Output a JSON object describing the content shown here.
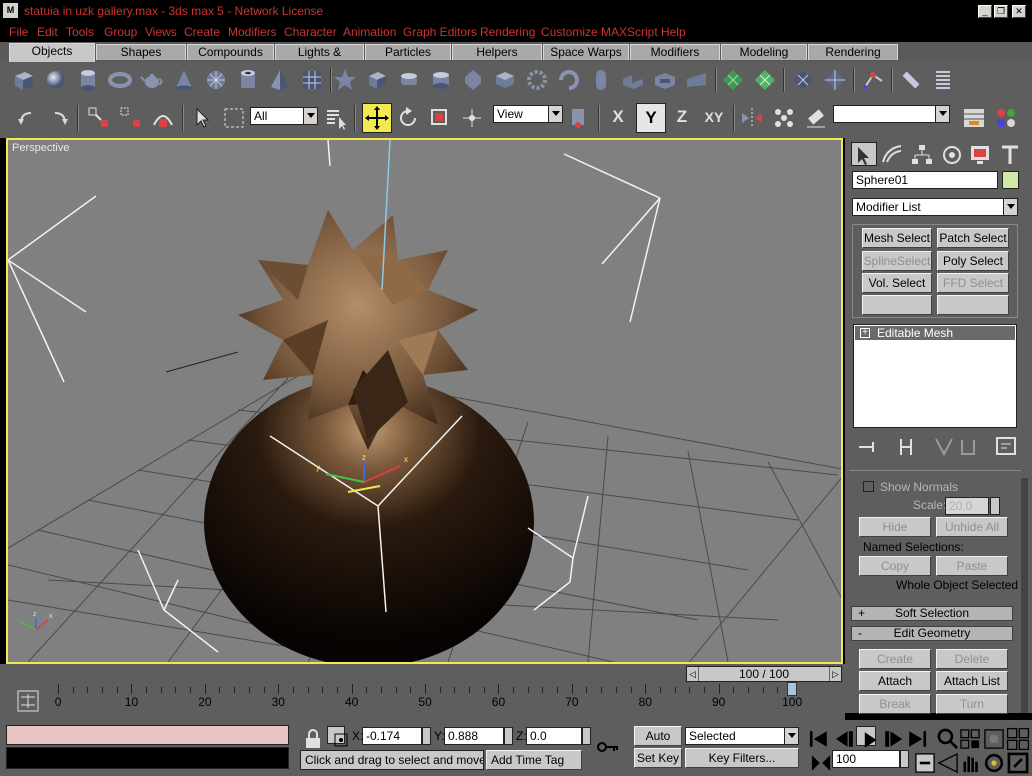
{
  "window": {
    "title": "statuia in uzk gallery.max - 3ds max 5 - Network License",
    "app_icon": "max-logo-icon",
    "controls": [
      "_",
      "❐",
      "✕"
    ]
  },
  "menu": [
    "File",
    "Edit",
    "Tools",
    "Group",
    "Views",
    "Create",
    "Modifiers",
    "Character",
    "Animation",
    "Graph Editors",
    "Rendering",
    "Customize",
    "MAXScript",
    "Help"
  ],
  "tabs": [
    "Objects",
    "Shapes",
    "Compounds",
    "Lights & Cameras",
    "Particles",
    "Helpers",
    "Space Warps",
    "Modifiers",
    "Modeling",
    "Rendering"
  ],
  "active_tab": "Objects",
  "toolbar": {
    "selection_filter": "All",
    "ref_coord": "View",
    "axes": [
      "X",
      "Y",
      "Z",
      "XY"
    ],
    "named_selection": ""
  },
  "viewport": {
    "label": "Perspective",
    "axis_labels": [
      "x",
      "y",
      "z"
    ]
  },
  "command_panel": {
    "object_name": "Sphere01",
    "object_color": "#cfe8a8",
    "modifier_list": "Modifier List",
    "modifier_buttons": [
      {
        "label": "Mesh Select",
        "enabled": true
      },
      {
        "label": "Patch Select",
        "enabled": true
      },
      {
        "label": "SplineSelect",
        "enabled": false
      },
      {
        "label": "Poly Select",
        "enabled": true
      },
      {
        "label": "Vol. Select",
        "enabled": true
      },
      {
        "label": "FFD Select",
        "enabled": false
      },
      {
        "label": "",
        "enabled": true
      },
      {
        "label": "",
        "enabled": true
      }
    ],
    "stack_items": [
      "Editable Mesh"
    ],
    "stack_expand": "+",
    "show_normals_label": "Show Normals",
    "scale_label": "Scale:",
    "scale_value": "20.0",
    "hide_label": "Hide",
    "unhide_all_label": "Unhide All",
    "named_selections_label": "Named Selections:",
    "copy_label": "Copy",
    "paste_label": "Paste",
    "whole_object_label": "Whole Object Selected",
    "soft_selection_label": "Soft Selection",
    "soft_selection_sign": "+",
    "edit_geometry_label": "Edit Geometry",
    "edit_geometry_sign": "-",
    "create_label": "Create",
    "delete_label": "Delete",
    "attach_label": "Attach",
    "attach_list_label": "Attach List",
    "break_label": "Break",
    "turn_label": "Turn"
  },
  "timeline": {
    "slider_text": "100 / 100",
    "labels": [
      "0",
      "10",
      "20",
      "30",
      "40",
      "50",
      "60",
      "70",
      "80",
      "90",
      "100"
    ],
    "current_frame": 100
  },
  "status": {
    "prompt": "Click and drag to select and move obj",
    "add_time_tag": "Add Time Tag",
    "x_label": "X:",
    "x_value": "-0.174",
    "y_label": "Y:",
    "y_value": "0.888",
    "z_label": "Z:",
    "z_value": "0.0",
    "auto_key": "Auto Key",
    "set_key": "Set Key",
    "key_mode": "Selected",
    "key_filters": "Key Filters...",
    "frame_field": "100"
  }
}
